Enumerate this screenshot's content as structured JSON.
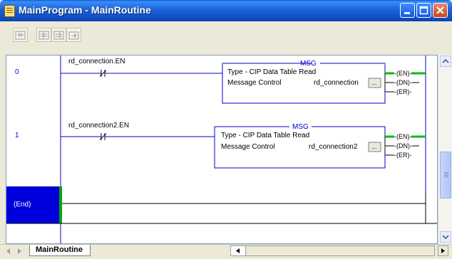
{
  "window": {
    "title": "MainProgram - MainRoutine"
  },
  "toolbar": {
    "buttons": [
      "verify-routine-icon",
      "online-edit-icon",
      "accept-edits-icon",
      "test-edits-icon"
    ]
  },
  "rungs": [
    {
      "number": "0",
      "contact_tag": "rd_connection.EN",
      "instruction": "MSG",
      "type_line": "Type - CIP Data Table Read",
      "param_label": "Message Control",
      "param_value": "rd_connection",
      "outputs": [
        "EN",
        "DN",
        "ER"
      ],
      "browse_label": "..."
    },
    {
      "number": "1",
      "contact_tag": "rd_connection2.EN",
      "instruction": "MSG",
      "type_line": "Type - CIP Data Table Read",
      "param_label": "Message Control",
      "param_value": "rd_connection2",
      "outputs": [
        "EN",
        "DN",
        "ER"
      ],
      "browse_label": "..."
    }
  ],
  "end_rung": {
    "label": "(End)"
  },
  "tabs": [
    {
      "label": "MainRoutine"
    }
  ],
  "colors": {
    "accent_blue": "#0000ff",
    "rung_blue": "#0000cc",
    "status_green": "#00c000",
    "end_fill": "#0000dd"
  }
}
